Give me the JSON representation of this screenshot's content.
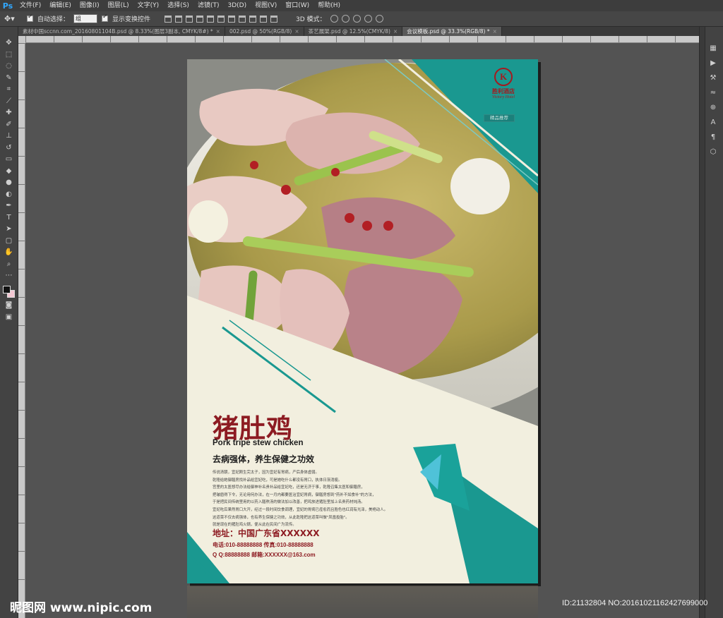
{
  "app": {
    "logo": "Ps"
  },
  "menu": [
    "文件(F)",
    "编辑(E)",
    "图像(I)",
    "图层(L)",
    "文字(Y)",
    "选择(S)",
    "滤镜(T)",
    "3D(D)",
    "视图(V)",
    "窗口(W)",
    "帮助(H)"
  ],
  "options": {
    "auto_select_label": "自动选择：",
    "auto_select_value": "组",
    "transform_label": "显示变换控件",
    "mode_label": "3D 模式："
  },
  "tabs": [
    {
      "label": "素材中国sccnn.com_20160801104B.psd @ 8.33%(图层3副本, CMYK/8#) *",
      "active": false
    },
    {
      "label": "002.psd @ 50%(RGB/8)",
      "active": false
    },
    {
      "label": "茶艺展架.psd @ 12.5%(CMYK/8)",
      "active": false
    },
    {
      "label": "会议模板.psd @ 33.3%(RGB/8) *",
      "active": true
    }
  ],
  "poster": {
    "hotel_cn": "胜利酒店",
    "hotel_en": "Victory Hotel",
    "hotel_mark": "K",
    "tag": "精品推荐",
    "title_cn": "猪肚鸡",
    "title_en": "Pork tripe stew chicken",
    "subtitle": "去病强体，养生保健之功效",
    "body": [
      "传说清朝，宜妃刚生完太子，因为宜妃有胃病，产后身体虚弱。",
      "乾隆给她御膳房找补品给宜妃吃，可是她吃什么都没有胃口，执体日渐消瘦。",
      "宫里的太医想尽办法给御神补名贵补品给宜妃吃，还是无济于事，乾隆召集太医和御膳房，",
      "把皱眉得下令，无论用何办法，在一月内都要医治宜妃胃病，御膳房想到\"药补不如食补\"的方法，",
      "于是把民间传统里用的以药入膳熬汤的做法加以改善，把鸡放进猪肚里加上名贵药材炖汤。",
      "宜妃吃后果然胃口大开，经过一段时间饮食调理，宜妃的胃病已痊愈而且脸色也红润有光泽，美艳动人。",
      "这道菜不仅去病强体，也有养生保健之功效，从此乾隆把这道菜叫做\"凤凰投胎\"。",
      "就是现在的猪肚鸡火锅，便从此在民间广为流传。"
    ],
    "address": "地址：中国广东省XXXXXX",
    "phone": "电话:010-88888888  传真:010-88888888",
    "qq": "Q Q:88888888  邮箱:XXXXXX@163.com"
  },
  "watermark": {
    "site": "昵图网 www.nipic.com",
    "id": "ID:21132804 NO:20161021162427699000"
  },
  "colors": {
    "teal": "#1b9a93",
    "red": "#8d1b22",
    "cream": "#f2efdf"
  }
}
